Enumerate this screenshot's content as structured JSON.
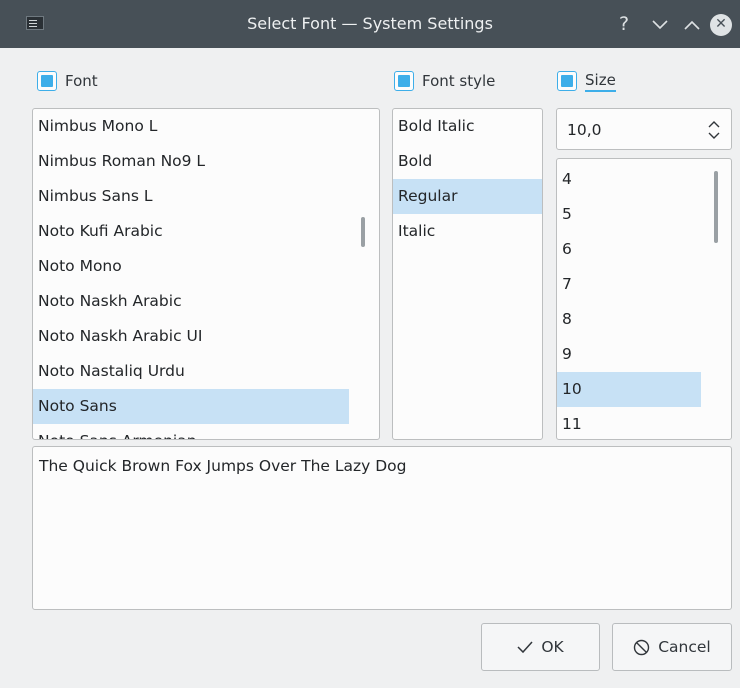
{
  "window": {
    "title": "Select Font — System Settings",
    "help_glyph": "?",
    "minimize_glyph": "⌄",
    "maximize_glyph": "⌃",
    "close_glyph": "✕"
  },
  "font_column": {
    "header": "Font",
    "items": [
      "Nimbus Mono L",
      "Nimbus Roman No9 L",
      "Nimbus Sans L",
      "Noto Kufi Arabic",
      "Noto Mono",
      "Noto Naskh Arabic",
      "Noto Naskh Arabic UI",
      "Noto Nastaliq Urdu",
      "Noto Sans",
      "Noto Sans Armenian"
    ],
    "selected": "Noto Sans"
  },
  "style_column": {
    "header": "Font style",
    "items": [
      "Bold Italic",
      "Bold",
      "Regular",
      "Italic"
    ],
    "selected": "Regular"
  },
  "size_column": {
    "header": "Size",
    "spin_value": "10,0",
    "items": [
      "4",
      "5",
      "6",
      "7",
      "8",
      "9",
      "10",
      "11"
    ],
    "selected": "10"
  },
  "preview": {
    "text": "The Quick Brown Fox Jumps Over The Lazy Dog"
  },
  "buttons": {
    "ok": "OK",
    "cancel": "Cancel"
  },
  "colors": {
    "accent": "#3daee9",
    "selection": "#c7e1f5",
    "titlebar": "#475057",
    "background": "#eff0f1"
  },
  "icons": {
    "window": "window-icon",
    "ok": "checkmark-icon",
    "cancel": "cancel-icon"
  }
}
